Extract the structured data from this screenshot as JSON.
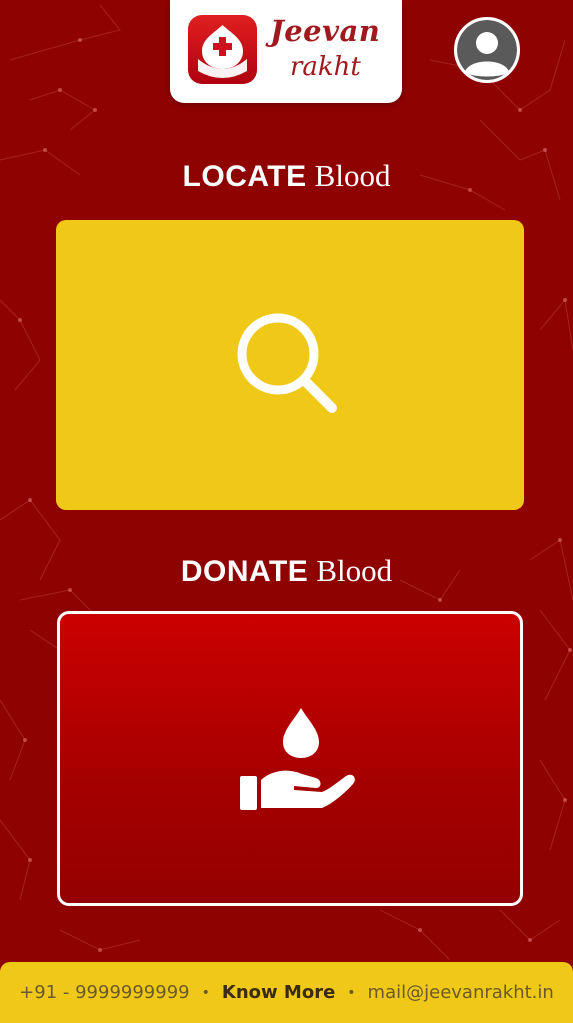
{
  "header": {
    "logo_word1": "Jeevan",
    "logo_word2": "rakht",
    "logo_icon": "blood-drop-cross-icon",
    "profile_icon": "user-avatar-icon"
  },
  "locate": {
    "title_strong": "LOCATE",
    "title_soft": "Blood",
    "icon": "search-icon"
  },
  "donate": {
    "title_strong": "DONATE",
    "title_soft": "Blood",
    "icon": "hand-blood-drop-icon"
  },
  "footer": {
    "phone": "+91 - 9999999999",
    "separator": "•",
    "know_more": "Know More",
    "email": "mail@jeevanrakht.in"
  },
  "colors": {
    "background": "#8f0202",
    "accent_yellow": "#f0c818",
    "donate_red": "#cc0000",
    "brand_red": "#a0191e"
  }
}
